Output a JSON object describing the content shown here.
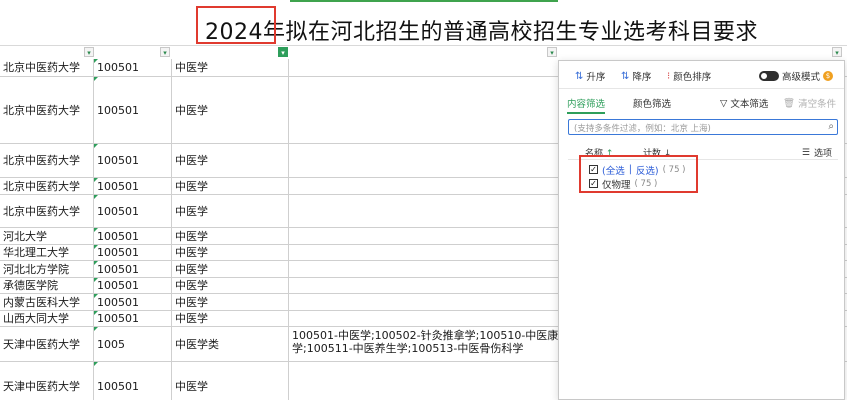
{
  "sheet": {
    "title": "2024年拟在河北招生的普通高校招生专业选考科目要求",
    "rows": [
      {
        "school": "北京中医药大学",
        "code": "100501",
        "major": "中医学",
        "detail": "",
        "h": 18
      },
      {
        "school": "北京中医药大学",
        "code": "100501",
        "major": "中医学",
        "detail": "",
        "h": 67
      },
      {
        "school": "北京中医药大学",
        "code": "100501",
        "major": "中医学",
        "detail": "",
        "h": 34
      },
      {
        "school": "北京中医药大学",
        "code": "100501",
        "major": "中医学",
        "detail": "",
        "h": 17
      },
      {
        "school": "北京中医药大学",
        "code": "100501",
        "major": "中医学",
        "detail": "",
        "h": 33
      },
      {
        "school": "河北大学",
        "code": "100501",
        "major": "中医学",
        "detail": "",
        "h": 17
      },
      {
        "school": "华北理工大学",
        "code": "100501",
        "major": "中医学",
        "detail": "",
        "h": 16
      },
      {
        "school": "河北北方学院",
        "code": "100501",
        "major": "中医学",
        "detail": "",
        "h": 17
      },
      {
        "school": "承德医学院",
        "code": "100501",
        "major": "中医学",
        "detail": "",
        "h": 16
      },
      {
        "school": "内蒙古医科大学",
        "code": "100501",
        "major": "中医学",
        "detail": "",
        "h": 17
      },
      {
        "school": "山西大同大学",
        "code": "100501",
        "major": "中医学",
        "detail": "",
        "h": 16
      },
      {
        "school": "天津中医药大学",
        "code": "1005",
        "major": "中医学类",
        "detail": "100501-中医学;100502-针灸推拿学;100510-中医康学;100511-中医养生学;100513-中医骨伤科学",
        "h": 35
      },
      {
        "school": "天津中医药大学",
        "code": "100501",
        "major": "中医学",
        "detail": "",
        "h": 50
      }
    ]
  },
  "filter_panel": {
    "toolbar": {
      "sort_asc": "升序",
      "sort_desc": "降序",
      "color_sort": "颜色排序",
      "advanced_mode": "高级模式"
    },
    "tabs": {
      "content_filter": "内容筛选",
      "color_filter": "颜色筛选",
      "text_filter": "文本筛选",
      "clear_condition": "清空条件"
    },
    "search_placeholder": "(支持多条件过滤，例如：北京  上海)",
    "list_header": {
      "name": "名称",
      "count": "计数",
      "options": "选项"
    },
    "items": [
      {
        "label_a": "(全选",
        "sep": "|",
        "label_b": "反选)",
        "count": "( 75 )"
      },
      {
        "label": "仅物理",
        "count": "( 75 )"
      }
    ]
  },
  "colors": {
    "accent_green": "#2e9e5b",
    "highlight_red": "#e03a2f",
    "link_blue": "#2a5bd7"
  }
}
